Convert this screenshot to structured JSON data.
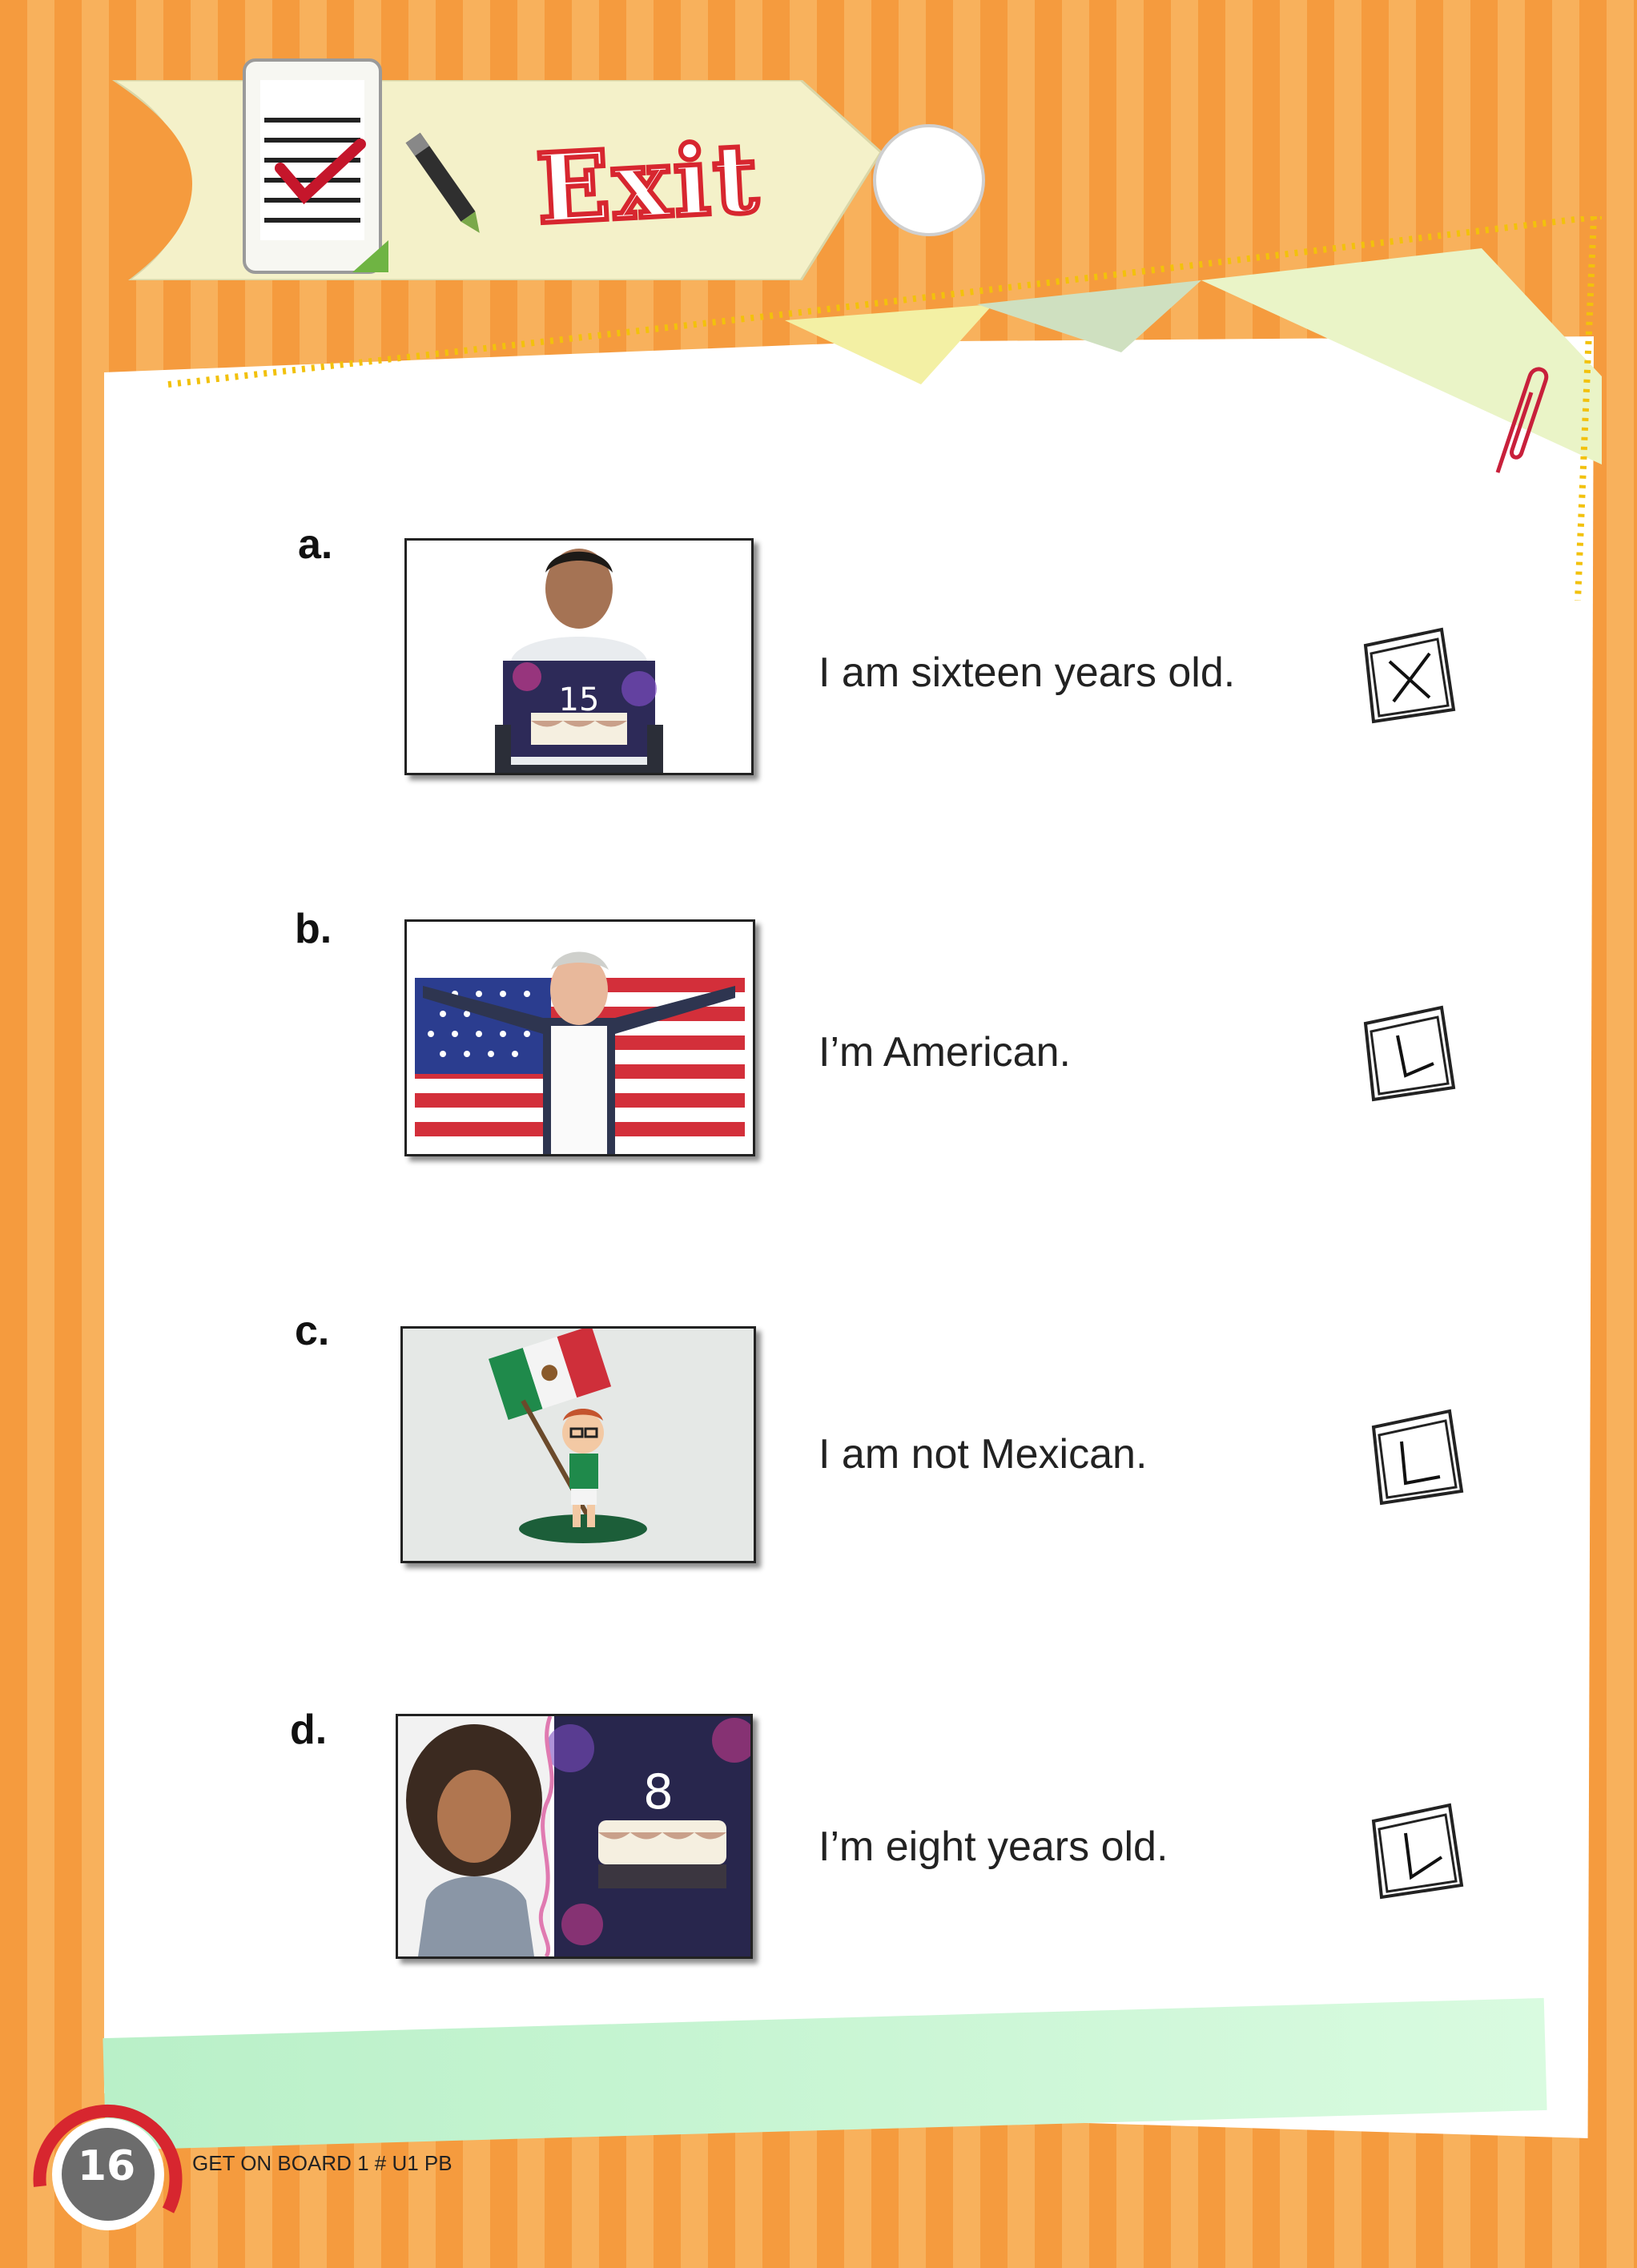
{
  "header": {
    "title": "Exit"
  },
  "items": [
    {
      "letter": "a.",
      "sentence": "I am sixteen years old.",
      "mark": "X",
      "photo": "boy-with-birthday-cake-15"
    },
    {
      "letter": "b.",
      "sentence": "I’m American.",
      "mark": "check",
      "photo": "man-with-american-flag"
    },
    {
      "letter": "c.",
      "sentence": "I am not Mexican.",
      "mark": "check",
      "photo": "cartoon-boy-with-mexican-flag"
    },
    {
      "letter": "d.",
      "sentence": "I’m eight years old.",
      "mark": "check",
      "photo": "girl-with-birthday-cake-8"
    }
  ],
  "photo_labels": {
    "cake_a": "15",
    "cake_d": "8"
  },
  "footer": {
    "page_number": "16",
    "book": "GET ON BOARD 1 # U1 PB"
  },
  "colors": {
    "background_stripe_a": "#f59b3e",
    "background_stripe_b": "#f8b15c",
    "title_red": "#d7262f"
  }
}
